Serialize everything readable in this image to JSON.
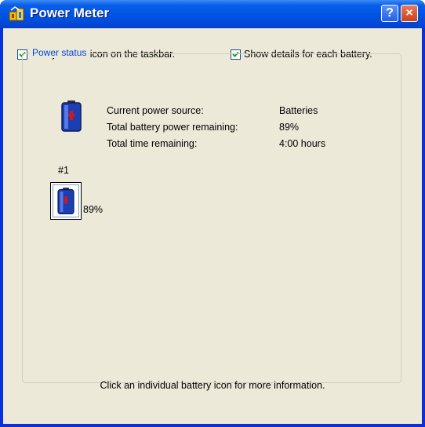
{
  "window": {
    "title": "Power Meter",
    "help_label": "?",
    "close_label": "×"
  },
  "options": {
    "always_show_icon": {
      "label": "Always show icon on the taskbar.",
      "checked": true
    },
    "show_details": {
      "label": "Show details for each battery.",
      "checked": true
    }
  },
  "power_status": {
    "legend": "Power status",
    "rows": [
      {
        "label": "Current power source:",
        "value": "Batteries"
      },
      {
        "label": "Total battery power remaining:",
        "value": "89%"
      },
      {
        "label": "Total time remaining:",
        "value": "4:00 hours"
      }
    ],
    "battery_icon": "battery-icon"
  },
  "batteries": [
    {
      "label": "#1",
      "percent": "89%",
      "icon": "battery-icon"
    }
  ],
  "footer": {
    "info": "Click an individual battery icon for more information."
  },
  "colors": {
    "title_bar": "#0055e5",
    "dialog_bg": "#ece9d8",
    "legend_text": "#0046d5",
    "close_button": "#c9411d"
  }
}
